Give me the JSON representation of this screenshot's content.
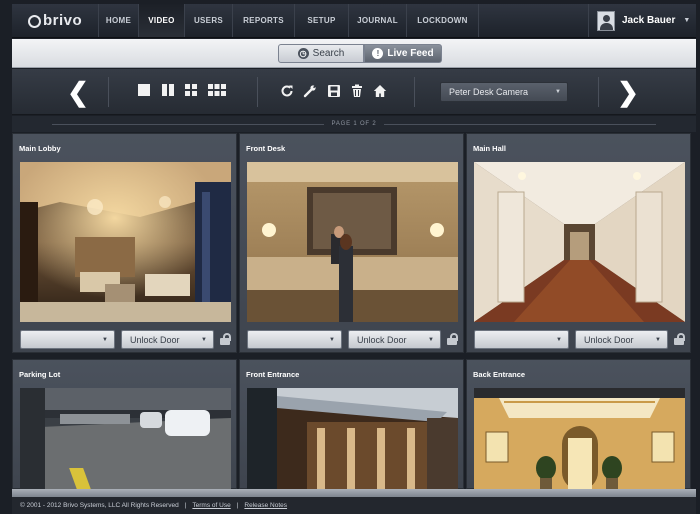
{
  "app": {
    "logo_text": "brivo",
    "nav": [
      "HOME",
      "VIDEO",
      "USERS",
      "REPORTS",
      "SETUP",
      "JOURNAL",
      "LOCKDOWN"
    ],
    "active_nav": "VIDEO",
    "user_name": "Jack Bauer"
  },
  "mode": {
    "search_label": "Search",
    "live_label": "Live Feed",
    "active": "Live Feed"
  },
  "toolbar": {
    "camera_select_value": "Peter Desk Camera",
    "page_label": "PAGE 1 OF 2"
  },
  "cameras": [
    {
      "name": "Main Lobby",
      "door_select_value": "",
      "action_label": "Unlock Door"
    },
    {
      "name": "Front Desk",
      "door_select_value": "",
      "action_label": "Unlock Door"
    },
    {
      "name": "Main Hall",
      "door_select_value": "",
      "action_label": "Unlock Door"
    },
    {
      "name": "Parking Lot"
    },
    {
      "name": "Front Entrance"
    },
    {
      "name": "Back Entrance"
    }
  ],
  "footer": {
    "copyright": "© 2001 - 2012 Brivo Systems, LLC All Rights Reserved",
    "terms_label": "Terms of Use",
    "release_notes_label": "Release Notes"
  },
  "colors": {
    "nav_bg": "#262b33",
    "tile_bg": "#454b55",
    "accent_live": "#6b727d"
  }
}
